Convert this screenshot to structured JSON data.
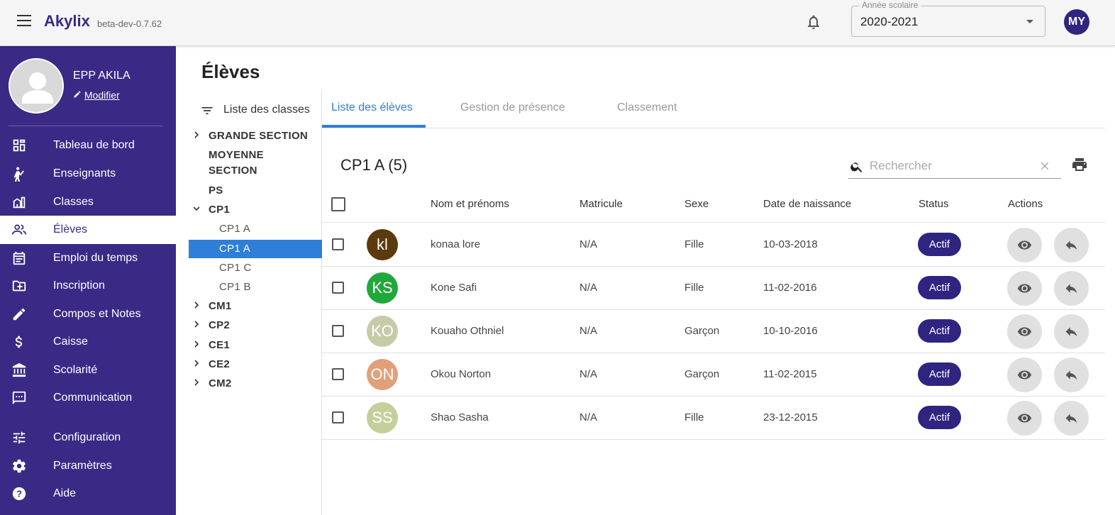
{
  "app": {
    "brand": "Akylix",
    "version": "beta-dev-0.7.62",
    "school_year_label": "Année scolaire",
    "school_year_value": "2020-2021",
    "user_initials": "MY",
    "icons": [
      "menu-icon",
      "bell-icon",
      "chevron-down-icon"
    ]
  },
  "sidebar": {
    "profile_name": "EPP AKILA",
    "edit_label": "Modifier",
    "items": [
      {
        "label": "Tableau de bord",
        "icon": "dashboard-icon"
      },
      {
        "label": "Enseignants",
        "icon": "teacher-icon"
      },
      {
        "label": "Classes",
        "icon": "building-icon"
      },
      {
        "label": "Élèves",
        "icon": "students-icon",
        "active": true
      },
      {
        "label": "Emploi du temps",
        "icon": "calendar-icon"
      },
      {
        "label": "Inscription",
        "icon": "folder-add-icon"
      },
      {
        "label": "Compos et Notes",
        "icon": "pencil-icon"
      },
      {
        "label": "Caisse",
        "icon": "dollar-icon"
      },
      {
        "label": "Scolarité",
        "icon": "bank-icon"
      },
      {
        "label": "Communication",
        "icon": "chat-icon"
      },
      {
        "label": "Configuration",
        "icon": "sliders-icon"
      },
      {
        "label": "Paramètres",
        "icon": "gear-icon"
      },
      {
        "label": "Aide",
        "icon": "help-icon"
      }
    ]
  },
  "page": {
    "title": "Élèves"
  },
  "class_tree": {
    "header": "Liste des classes",
    "items": [
      {
        "name": "GRANDE SECTION",
        "expandable": true,
        "expanded": false
      },
      {
        "name": "MOYENNE SECTION",
        "expandable": false
      },
      {
        "name": "PS",
        "expandable": false
      },
      {
        "name": "CP1",
        "expandable": true,
        "expanded": true
      },
      {
        "name": "CP1 A",
        "child": true
      },
      {
        "name": "CP1 A",
        "child": true,
        "selected": true
      },
      {
        "name": "CP1 C",
        "child": true
      },
      {
        "name": "CP1 B",
        "child": true
      },
      {
        "name": "CM1",
        "expandable": true,
        "expanded": false
      },
      {
        "name": "CP2",
        "expandable": true,
        "expanded": false
      },
      {
        "name": "CE1",
        "expandable": true,
        "expanded": false
      },
      {
        "name": "CE2",
        "expandable": true,
        "expanded": false
      },
      {
        "name": "CM2",
        "expandable": true,
        "expanded": false
      }
    ]
  },
  "tabs": [
    {
      "label": "Liste des élèves",
      "active": true
    },
    {
      "label": "Gestion de présence",
      "active": false
    },
    {
      "label": "Classement",
      "active": false
    }
  ],
  "list": {
    "class_title": "CP1 A (5)",
    "search_placeholder": "Rechercher",
    "columns": [
      "Nom et prénoms",
      "Matricule",
      "Sexe",
      "Date de naissance",
      "Status",
      "Actions"
    ],
    "rows": [
      {
        "initials": "kl",
        "avatar_color": "#5b3a0e",
        "name": "konaa lore",
        "matricule": "N/A",
        "sexe": "Fille",
        "birth": "10-03-2018",
        "status": "Actif"
      },
      {
        "initials": "KS",
        "avatar_color": "#21a83a",
        "name": "Kone Safi",
        "matricule": "N/A",
        "sexe": "Fille",
        "birth": "11-02-2016",
        "status": "Actif"
      },
      {
        "initials": "KO",
        "avatar_color": "#c8cba8",
        "name": "Kouaho Othniel",
        "matricule": "N/A",
        "sexe": "Garçon",
        "birth": "10-10-2016",
        "status": "Actif"
      },
      {
        "initials": "ON",
        "avatar_color": "#e0a07a",
        "name": "Okou Norton",
        "matricule": "N/A",
        "sexe": "Garçon",
        "birth": "11-02-2015",
        "status": "Actif"
      },
      {
        "initials": "SS",
        "avatar_color": "#c5cf9a",
        "name": "Shao Sasha",
        "matricule": "N/A",
        "sexe": "Fille",
        "birth": "23-12-2015",
        "status": "Actif"
      }
    ],
    "action_icons": [
      "eye-icon",
      "reply-icon"
    ]
  },
  "colors": {
    "sidebar_bg": "#3a2a86",
    "accent_blue": "#2f7ed8",
    "badge": "#2f2480"
  }
}
